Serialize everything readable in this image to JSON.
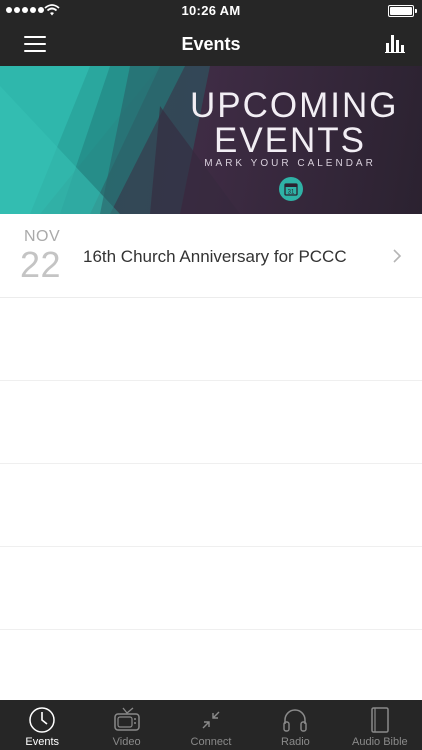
{
  "status_bar": {
    "time": "10:26 AM"
  },
  "nav_bar": {
    "title": "Events"
  },
  "banner": {
    "line1": "UPCOMING",
    "line2": "EVENTS",
    "subtitle": "MARK YOUR CALENDAR",
    "calendar_day": "31"
  },
  "events": [
    {
      "month": "NOV",
      "day": "22",
      "title": "16th Church Anniversary for PCCC"
    }
  ],
  "tabs": [
    {
      "label": "Events",
      "icon": "clock-icon",
      "active": true
    },
    {
      "label": "Video",
      "icon": "tv-icon",
      "active": false
    },
    {
      "label": "Connect",
      "icon": "connect-arrows-icon",
      "active": false
    },
    {
      "label": "Radio",
      "icon": "headphones-icon",
      "active": false
    },
    {
      "label": "Audio Bible",
      "icon": "book-icon",
      "active": false
    }
  ],
  "colors": {
    "bar_background": "#262626",
    "banner_teal": "#2fb2a6",
    "banner_purple": "#3f2c45",
    "tab_active": "#ffffff",
    "tab_inactive": "#8a8a8a"
  }
}
